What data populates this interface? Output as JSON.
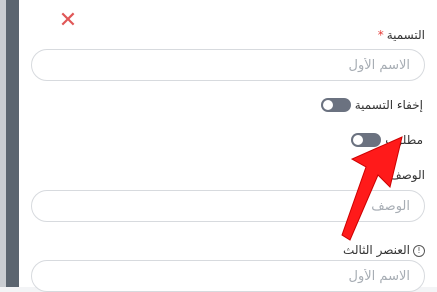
{
  "form": {
    "close_glyph": "✕",
    "name_label": "التسمية",
    "required_mark": "*",
    "name_placeholder": "الاسم الأول",
    "hide_label_toggle": "إخفاء التسمية",
    "required_toggle": "مطلوب",
    "description_label": "الوصف",
    "description_placeholder": "الوصف",
    "third_element_label": "العنصر الثالث",
    "info_glyph": "!",
    "third_placeholder": "الاسم الأول"
  },
  "colors": {
    "accent_close": "#e05757",
    "required_star": "#e53935",
    "toggle_off": "#6b7280",
    "annotation_arrow": "#ff1a1a"
  }
}
